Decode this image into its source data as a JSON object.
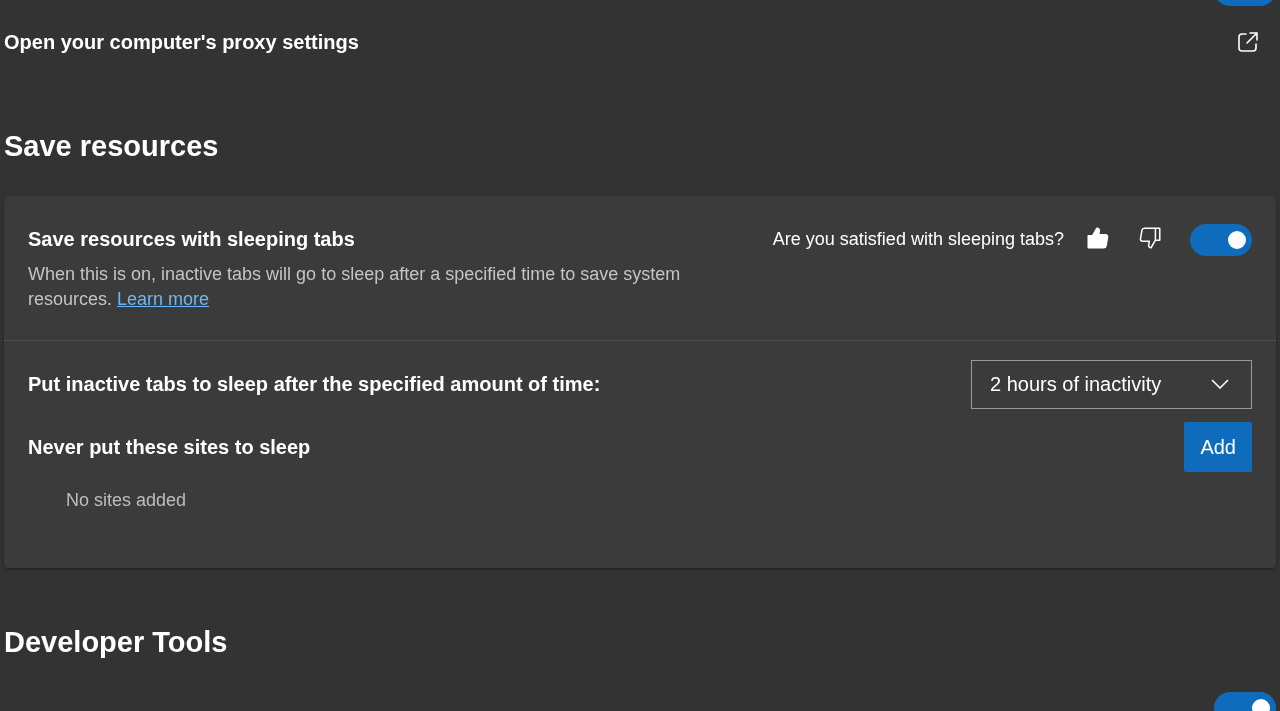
{
  "top_toggle": {
    "on": true
  },
  "proxy_link": {
    "label": "Open your computer's proxy settings"
  },
  "sections": [
    {
      "title": "Save resources"
    },
    {
      "title": "Developer Tools"
    }
  ],
  "sleeping_tabs": {
    "title": "Save resources with sleeping tabs",
    "description": "When this is on, inactive tabs will go to sleep after a specified time to save system resources.",
    "link": "Learn more",
    "feedback_question": "Are you satisfied with sleeping tabs?",
    "thumbs_up_selected": true,
    "thumbs_down_selected": false,
    "on": true
  },
  "sleep_after": {
    "label": "Put inactive tabs to sleep after the specified amount of time:",
    "value": "2 hours of inactivity"
  },
  "never_sleep": {
    "label": "Never put these sites to sleep",
    "button": "Add",
    "empty": "No sites added"
  },
  "bottom_toggle": {
    "on": true
  }
}
